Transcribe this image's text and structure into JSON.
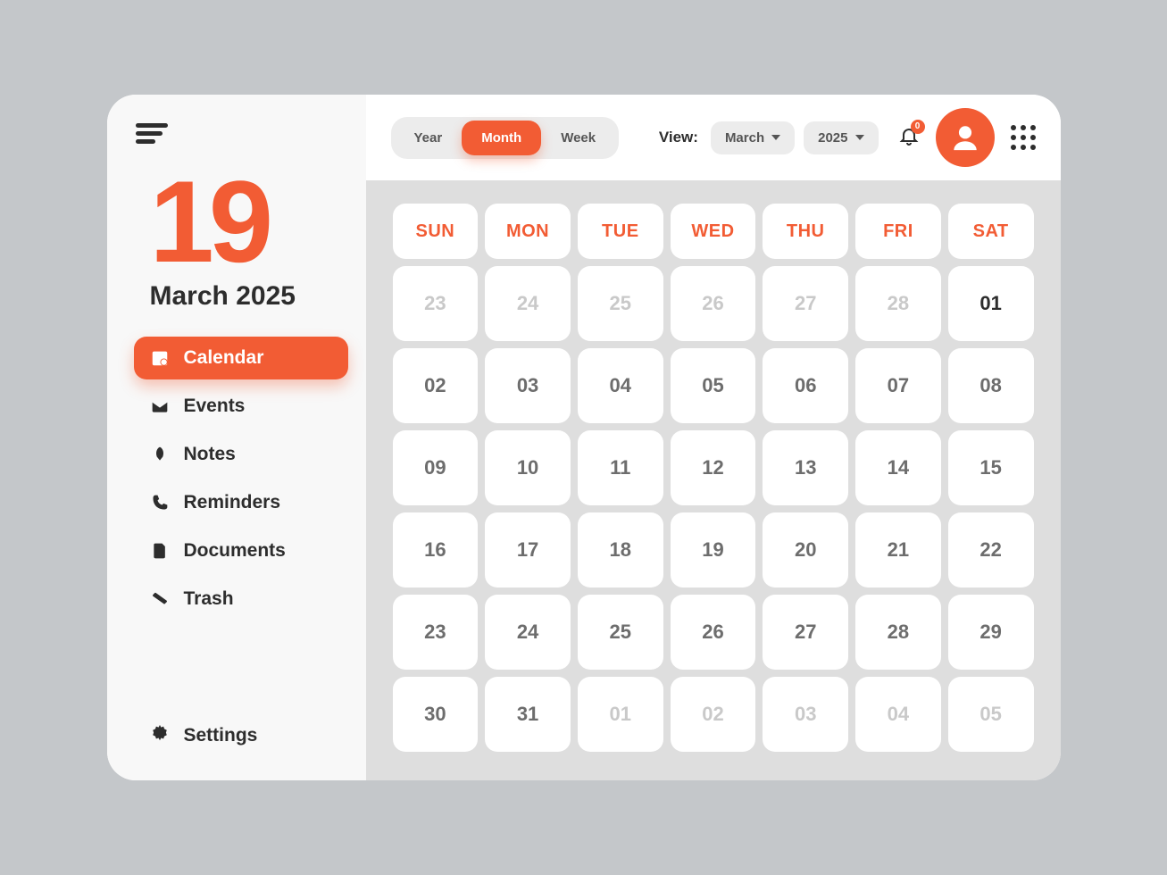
{
  "sidebar": {
    "big_day": "19",
    "month_year": "March 2025",
    "nav": [
      {
        "label": "Calendar",
        "active": true,
        "icon": "calendar"
      },
      {
        "label": "Events",
        "active": false,
        "icon": "mail"
      },
      {
        "label": "Notes",
        "active": false,
        "icon": "rocket"
      },
      {
        "label": "Reminders",
        "active": false,
        "icon": "phone"
      },
      {
        "label": "Documents",
        "active": false,
        "icon": "document"
      },
      {
        "label": "Trash",
        "active": false,
        "icon": "trash"
      }
    ],
    "settings_label": "Settings"
  },
  "topbar": {
    "segments": [
      {
        "label": "Year",
        "active": false
      },
      {
        "label": "Month",
        "active": true
      },
      {
        "label": "Week",
        "active": false
      }
    ],
    "view_label": "View:",
    "month_dropdown": "March",
    "year_dropdown": "2025",
    "notification_count": "0"
  },
  "calendar": {
    "day_labels": [
      "SUN",
      "MON",
      "TUE",
      "WED",
      "THU",
      "FRI",
      "SAT"
    ],
    "cells": [
      {
        "n": "23",
        "out": true
      },
      {
        "n": "24",
        "out": true
      },
      {
        "n": "25",
        "out": true
      },
      {
        "n": "26",
        "out": true
      },
      {
        "n": "27",
        "out": true
      },
      {
        "n": "28",
        "out": true
      },
      {
        "n": "01",
        "first": true
      },
      {
        "n": "02"
      },
      {
        "n": "03"
      },
      {
        "n": "04"
      },
      {
        "n": "05"
      },
      {
        "n": "06"
      },
      {
        "n": "07"
      },
      {
        "n": "08"
      },
      {
        "n": "09"
      },
      {
        "n": "10"
      },
      {
        "n": "11"
      },
      {
        "n": "12"
      },
      {
        "n": "13"
      },
      {
        "n": "14"
      },
      {
        "n": "15"
      },
      {
        "n": "16"
      },
      {
        "n": "17"
      },
      {
        "n": "18"
      },
      {
        "n": "19"
      },
      {
        "n": "20"
      },
      {
        "n": "21"
      },
      {
        "n": "22"
      },
      {
        "n": "23"
      },
      {
        "n": "24"
      },
      {
        "n": "25"
      },
      {
        "n": "26"
      },
      {
        "n": "27"
      },
      {
        "n": "28"
      },
      {
        "n": "29"
      },
      {
        "n": "30"
      },
      {
        "n": "31"
      },
      {
        "n": "01",
        "out": true
      },
      {
        "n": "02",
        "out": true
      },
      {
        "n": "03",
        "out": true
      },
      {
        "n": "04",
        "out": true
      },
      {
        "n": "05",
        "out": true
      }
    ]
  },
  "colors": {
    "accent": "#f25c34",
    "bg": "#c4c7ca"
  }
}
